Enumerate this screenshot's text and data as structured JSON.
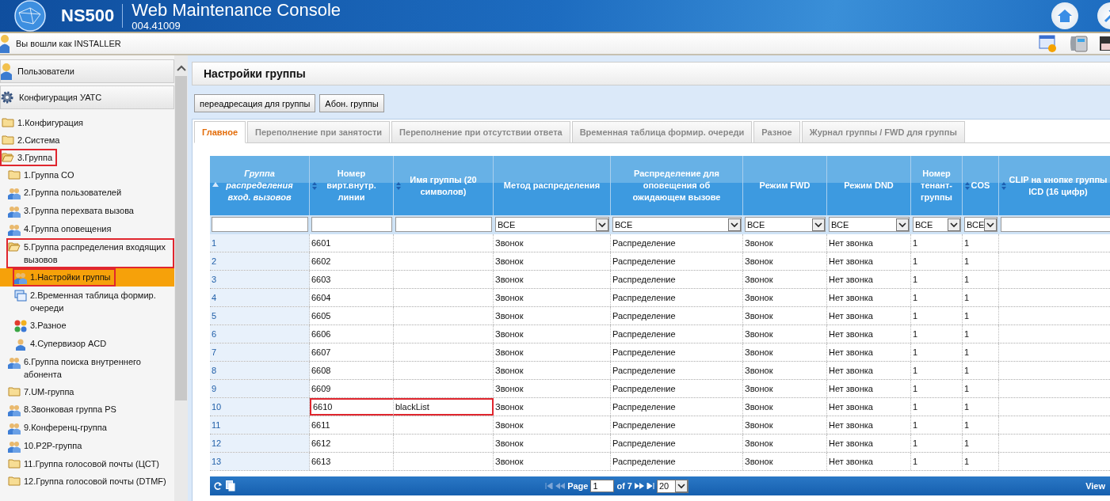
{
  "header": {
    "product": "NS500",
    "title": "Web Maintenance Console",
    "version": "004.41009"
  },
  "user_bar": {
    "text": "Вы вошли как INSTALLER"
  },
  "sidebar": {
    "panels": [
      {
        "label": "Пользователи",
        "kind": "user"
      },
      {
        "label": "Конфигурация УАТС",
        "kind": "gear"
      }
    ],
    "items": [
      {
        "label": "1.Конфигурация",
        "kind": "folder",
        "expanded": false,
        "highlighted": false,
        "selected": false
      },
      {
        "label": "2.Система",
        "kind": "folder",
        "expanded": false,
        "highlighted": false,
        "selected": false
      },
      {
        "label": "3.Группа",
        "kind": "folder",
        "expanded": true,
        "highlighted": true,
        "selected": false,
        "children": [
          {
            "label": "1.Группа CO",
            "kind": "folder",
            "expanded": false,
            "highlighted": false,
            "selected": false
          },
          {
            "label": "2.Группа пользователей",
            "kind": "people",
            "highlighted": false,
            "selected": false
          },
          {
            "label": "3.Группа перехвата вызова",
            "kind": "people",
            "highlighted": false,
            "selected": false
          },
          {
            "label": "4.Группа оповещения",
            "kind": "people",
            "highlighted": false,
            "selected": false
          },
          {
            "label": "5.Группа распределения входящих вызовов",
            "kind": "folder",
            "expanded": true,
            "highlighted": true,
            "selected": false,
            "children": [
              {
                "label": "1.Настройки группы",
                "kind": "people",
                "highlighted": true,
                "selected": true
              },
              {
                "label": "2.Временная таблица формир. очереди",
                "kind": "windows",
                "highlighted": false,
                "selected": false
              },
              {
                "label": "3.Разное",
                "kind": "balls",
                "highlighted": false,
                "selected": false
              },
              {
                "label": "4.Супервизор ACD",
                "kind": "person",
                "highlighted": false,
                "selected": false
              }
            ]
          },
          {
            "label": "6.Группа поиска внутреннего абонента",
            "kind": "people",
            "highlighted": false,
            "selected": false
          },
          {
            "label": "7.UM-группа",
            "kind": "folder",
            "expanded": false,
            "highlighted": false,
            "selected": false
          },
          {
            "label": "8.Звонковая группа PS",
            "kind": "people",
            "highlighted": false,
            "selected": false
          },
          {
            "label": "9.Конференц-группа",
            "kind": "people",
            "highlighted": false,
            "selected": false
          },
          {
            "label": "10.P2P-группа",
            "kind": "people",
            "highlighted": false,
            "selected": false
          },
          {
            "label": "11.Группа голосовой почты (ЦСТ)",
            "kind": "folder",
            "expanded": false,
            "highlighted": false,
            "selected": false
          },
          {
            "label": "12.Группа голосовой почты (DTMF)",
            "kind": "folder",
            "expanded": false,
            "highlighted": false,
            "selected": false
          }
        ]
      }
    ]
  },
  "page_title": "Настройки группы",
  "buttons": [
    "переадресация для группы",
    "Абон. группы"
  ],
  "tabs": [
    {
      "label": "Главное",
      "selected": true
    },
    {
      "label": "Переполнение при занятости",
      "selected": false
    },
    {
      "label": "Переполнение при отсутствии ответа",
      "selected": false
    },
    {
      "label": "Временная таблица формир. очереди",
      "selected": false
    },
    {
      "label": "Разное",
      "selected": false
    },
    {
      "label": "Журнал группы / FWD для группы",
      "selected": false
    }
  ],
  "table": {
    "columns": [
      {
        "label": "Группа распределения вход. вызовов",
        "sortable": true,
        "sorted": true,
        "filter": {
          "kind": "text"
        }
      },
      {
        "label": "Номер вирт.внутр. линии",
        "sortable": true,
        "sorted": false,
        "filter": {
          "kind": "text"
        }
      },
      {
        "label": "Имя группы (20 символов)",
        "sortable": true,
        "sorted": false,
        "filter": {
          "kind": "text"
        }
      },
      {
        "label": "Метод распределения",
        "sortable": false,
        "filter": {
          "kind": "select",
          "value": "ВСЕ"
        }
      },
      {
        "label": "Распределение для оповещения об ожидающем вызове",
        "sortable": false,
        "filter": {
          "kind": "select",
          "value": "ВСЕ"
        }
      },
      {
        "label": "Режим FWD",
        "sortable": false,
        "filter": {
          "kind": "select",
          "value": "ВСЕ"
        }
      },
      {
        "label": "Режим DND",
        "sortable": false,
        "filter": {
          "kind": "select",
          "value": "ВСЕ"
        }
      },
      {
        "label": "Номер тенант-группы",
        "sortable": false,
        "filter": {
          "kind": "select",
          "value": "ВСЕ"
        }
      },
      {
        "label": "COS",
        "sortable": true,
        "sorted": false,
        "filter": {
          "kind": "select",
          "value": "ВСЕ"
        }
      },
      {
        "label": "CLIP на кнопке группы ICD (16 цифр)",
        "sortable": true,
        "sorted": false,
        "filter": {
          "kind": "text"
        }
      }
    ],
    "rows": [
      {
        "cells": [
          "1",
          "6601",
          null,
          "Звонок",
          "Распределение",
          "Звонок",
          "Нет звонка",
          "1",
          "1",
          null
        ],
        "highlighted": false
      },
      {
        "cells": [
          "2",
          "6602",
          null,
          "Звонок",
          "Распределение",
          "Звонок",
          "Нет звонка",
          "1",
          "1",
          null
        ],
        "highlighted": false
      },
      {
        "cells": [
          "3",
          "6603",
          null,
          "Звонок",
          "Распределение",
          "Звонок",
          "Нет звонка",
          "1",
          "1",
          null
        ],
        "highlighted": false
      },
      {
        "cells": [
          "4",
          "6604",
          null,
          "Звонок",
          "Распределение",
          "Звонок",
          "Нет звонка",
          "1",
          "1",
          null
        ],
        "highlighted": false
      },
      {
        "cells": [
          "5",
          "6605",
          null,
          "Звонок",
          "Распределение",
          "Звонок",
          "Нет звонка",
          "1",
          "1",
          null
        ],
        "highlighted": false
      },
      {
        "cells": [
          "6",
          "6606",
          null,
          "Звонок",
          "Распределение",
          "Звонок",
          "Нет звонка",
          "1",
          "1",
          null
        ],
        "highlighted": false
      },
      {
        "cells": [
          "7",
          "6607",
          null,
          "Звонок",
          "Распределение",
          "Звонок",
          "Нет звонка",
          "1",
          "1",
          null
        ],
        "highlighted": false
      },
      {
        "cells": [
          "8",
          "6608",
          null,
          "Звонок",
          "Распределение",
          "Звонок",
          "Нет звонка",
          "1",
          "1",
          null
        ],
        "highlighted": false
      },
      {
        "cells": [
          "9",
          "6609",
          null,
          "Звонок",
          "Распределение",
          "Звонок",
          "Нет звонка",
          "1",
          "1",
          null
        ],
        "highlighted": false
      },
      {
        "cells": [
          "10",
          "6610",
          "blackList",
          "Звонок",
          "Распределение",
          "Звонок",
          "Нет звонка",
          "1",
          "1",
          null
        ],
        "highlighted": true
      },
      {
        "cells": [
          "11",
          "6611",
          null,
          "Звонок",
          "Распределение",
          "Звонок",
          "Нет звонка",
          "1",
          "1",
          null
        ],
        "highlighted": false
      },
      {
        "cells": [
          "12",
          "6612",
          null,
          "Звонок",
          "Распределение",
          "Звонок",
          "Нет звонка",
          "1",
          "1",
          null
        ],
        "highlighted": false
      },
      {
        "cells": [
          "13",
          "6613",
          null,
          "Звонок",
          "Распределение",
          "Звонок",
          "Нет звонка",
          "1",
          "1",
          null
        ],
        "highlighted": false
      }
    ]
  },
  "pager": {
    "page_label": "Page",
    "page": "1",
    "of_label": "of 7",
    "page_size": "20",
    "view_label": "View"
  }
}
